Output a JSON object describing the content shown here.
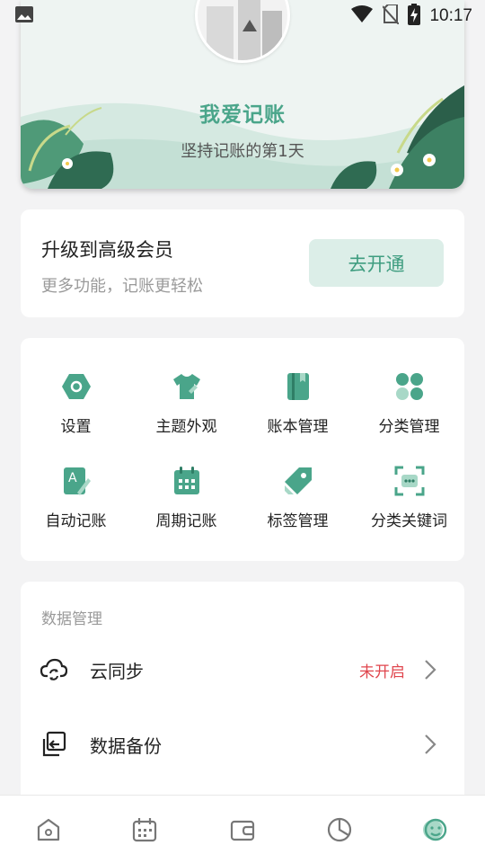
{
  "status_bar": {
    "time": "10:17",
    "icons": [
      "image-icon",
      "wifi-icon",
      "no-sim-icon",
      "battery-charging-icon"
    ]
  },
  "profile": {
    "app_name": "我爱记账",
    "subtitle": "坚持记账的第1天",
    "avatar": "avatar-image"
  },
  "vip": {
    "title": "升级到高级会员",
    "description": "更多功能，记账更轻松",
    "button_label": "去开通"
  },
  "features": [
    {
      "label": "设置",
      "icon": "settings-hexagon-icon"
    },
    {
      "label": "主题外观",
      "icon": "tshirt-icon"
    },
    {
      "label": "账本管理",
      "icon": "ledger-book-icon"
    },
    {
      "label": "分类管理",
      "icon": "category-grid-icon"
    },
    {
      "label": "自动记账",
      "icon": "auto-note-icon"
    },
    {
      "label": "周期记账",
      "icon": "calendar-icon"
    },
    {
      "label": "标签管理",
      "icon": "tag-icon"
    },
    {
      "label": "分类关键词",
      "icon": "keyword-scan-icon"
    }
  ],
  "data_management": {
    "section_title": "数据管理",
    "rows": [
      {
        "label": "云同步",
        "status": "未开启",
        "icon": "cloud-sync-icon"
      },
      {
        "label": "数据备份",
        "status": "",
        "icon": "backup-icon"
      }
    ]
  },
  "bottom_nav": [
    {
      "name": "home",
      "icon": "home-icon",
      "active": false
    },
    {
      "name": "calendar",
      "icon": "calendar-nav-icon",
      "active": false
    },
    {
      "name": "wallet",
      "icon": "wallet-icon",
      "active": false
    },
    {
      "name": "stats",
      "icon": "pie-chart-icon",
      "active": false
    },
    {
      "name": "mine",
      "icon": "smiley-icon",
      "active": true
    }
  ],
  "colors": {
    "accent": "#4aa58a",
    "accent_light": "#dceee8",
    "warning": "#e0464e",
    "background": "#f3f3f4"
  }
}
